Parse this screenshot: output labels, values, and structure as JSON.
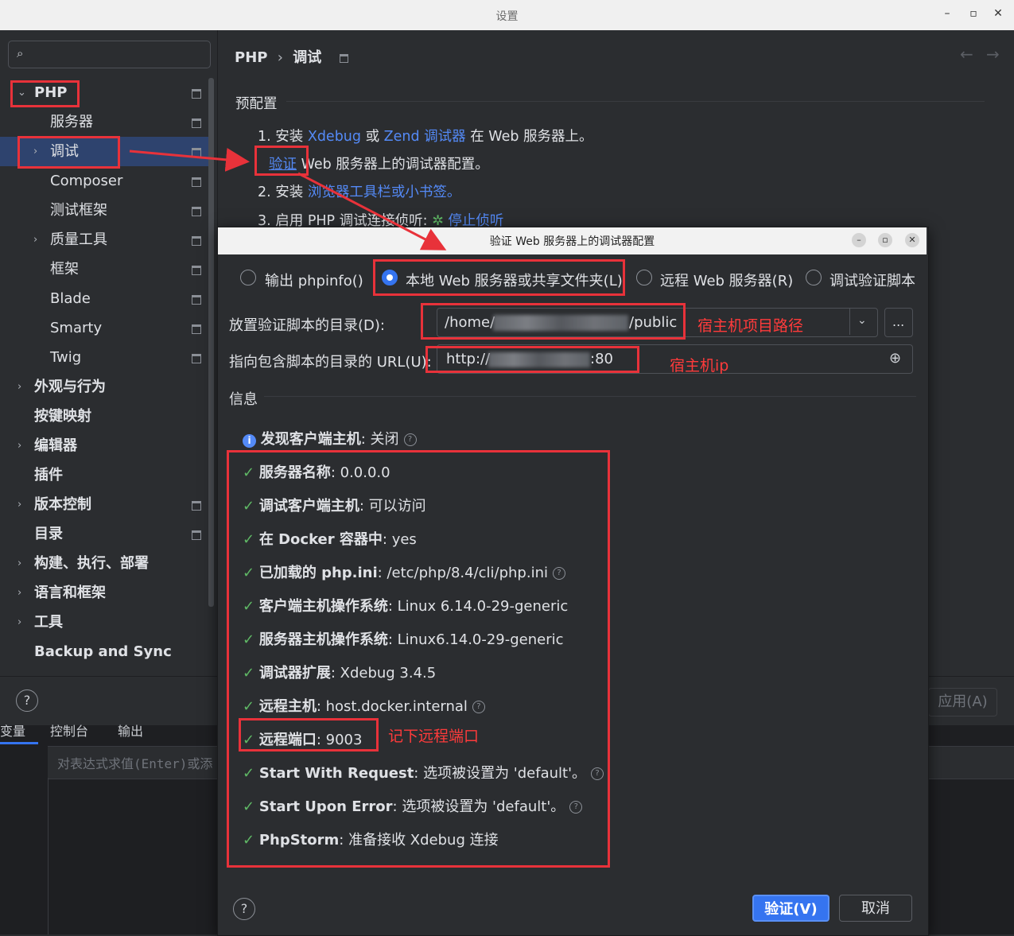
{
  "window": {
    "title": "设置"
  },
  "sidebar": {
    "search_placeholder": "",
    "items": [
      {
        "label": "PHP"
      },
      {
        "label": "服务器"
      },
      {
        "label": "调试"
      },
      {
        "label": "Composer"
      },
      {
        "label": "测试框架"
      },
      {
        "label": "质量工具"
      },
      {
        "label": "框架"
      },
      {
        "label": "Blade"
      },
      {
        "label": "Smarty"
      },
      {
        "label": "Twig"
      },
      {
        "label": "外观与行为"
      },
      {
        "label": "按键映射"
      },
      {
        "label": "编辑器"
      },
      {
        "label": "插件"
      },
      {
        "label": "版本控制"
      },
      {
        "label": "目录"
      },
      {
        "label": "构建、执行、部署"
      },
      {
        "label": "语言和框架"
      },
      {
        "label": "工具"
      },
      {
        "label": "Backup and Sync"
      }
    ]
  },
  "main": {
    "breadcrumb_root": "PHP",
    "breadcrumb_sep": "›",
    "breadcrumb_leaf": "调试",
    "preconfig_title": "预配置",
    "step1_prefix": "1. 安装 ",
    "step1_link1": "Xdebug",
    "step1_mid": " 或 ",
    "step1_link2": "Zend 调试器",
    "step1_suffix": " 在 Web 服务器上。",
    "step_verify_link": "验证",
    "step_verify_suffix": " Web 服务器上的调试器配置。",
    "step2_prefix": "2. 安装 ",
    "step2_link": "浏览器工具栏或小书签。",
    "step3_prefix": "3. 启用 PHP 调试连接侦听: ",
    "step3_link": "停止侦听",
    "apply_label": "应用(A)"
  },
  "bottom": {
    "tabs": [
      "变量",
      "控制台",
      "输出"
    ],
    "eval_placeholder": "对表达式求值(Enter)或添"
  },
  "dialog": {
    "title": "验证 Web 服务器上的调试器配置",
    "radios": [
      {
        "label": "输出 phpinfo()",
        "selected": false
      },
      {
        "label": "本地 Web 服务器或共享文件夹(L)",
        "selected": true
      },
      {
        "label": "远程 Web 服务器(R)",
        "selected": false
      },
      {
        "label": "调试验证脚本",
        "selected": false
      }
    ],
    "dir_label": "放置验证脚本的目录(D):",
    "dir_prefix": "/home/",
    "dir_suffix": "/public",
    "browse_label": "...",
    "url_label": "指向包含脚本的目录的 URL(U):",
    "url_prefix": "http://",
    "url_suffix": ":80",
    "info_title": "信息",
    "discover_label": "发现客户端主机",
    "discover_value": ": 关闭",
    "results": [
      {
        "key": "服务器名称",
        "value": ": 0.0.0.0",
        "help": false
      },
      {
        "key": "调试客户端主机",
        "value": ": 可以访问",
        "help": false
      },
      {
        "key": "在 Docker 容器中",
        "value": ": yes",
        "help": false
      },
      {
        "key": "已加载的 php.ini",
        "value": ": /etc/php/8.4/cli/php.ini",
        "help": true
      },
      {
        "key": "客户端主机操作系统",
        "value": ": Linux 6.14.0-29-generic",
        "help": false
      },
      {
        "key": "服务器主机操作系统",
        "value": ": Linux6.14.0-29-generic",
        "help": false
      },
      {
        "key": "调试器扩展",
        "value": ": Xdebug 3.4.5",
        "help": false
      },
      {
        "key": "远程主机",
        "value": ": host.docker.internal",
        "help": true
      },
      {
        "key": "远程端口",
        "value": ": 9003",
        "help": false
      },
      {
        "key": "Start With Request",
        "value": ": 选项被设置为 'default'。",
        "help": true
      },
      {
        "key": "Start Upon Error",
        "value": ": 选项被设置为 'default'。",
        "help": true
      },
      {
        "key": "PhpStorm",
        "value": ": 准备接收 Xdebug 连接",
        "help": false
      }
    ],
    "verify_button": "验证(V)",
    "cancel_button": "取消"
  },
  "annotations": {
    "host_path_note": "宿主机项目路径",
    "host_ip_note": "宿主机ip",
    "remote_port_note": "记下远程端口",
    "annotation_color": "#e8323a"
  },
  "colors": {
    "accent": "#3574f0",
    "link": "#548af7",
    "selection": "#2e436e",
    "check": "#5fb865"
  }
}
